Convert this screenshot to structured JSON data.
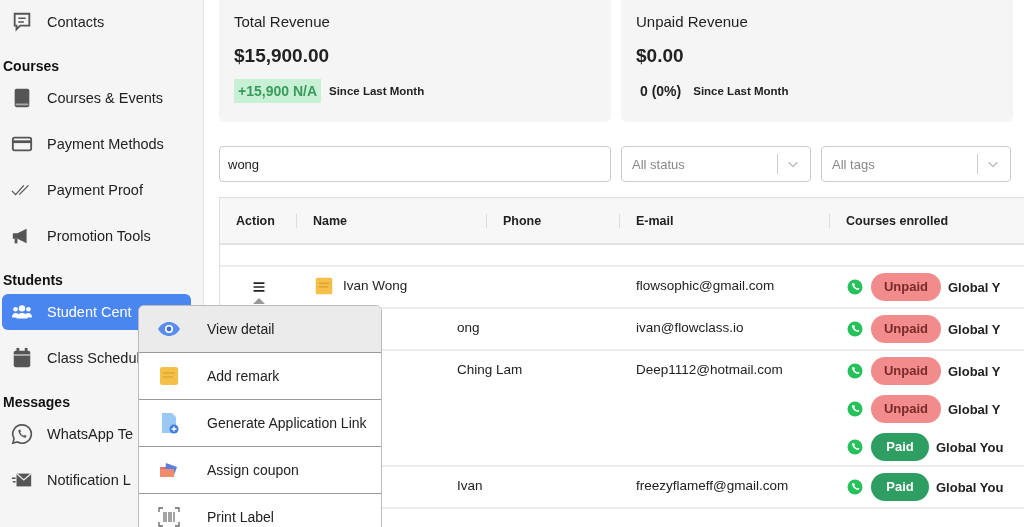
{
  "sidebar": {
    "sections": [
      {
        "items": [
          {
            "label": "Contacts",
            "selected": false
          }
        ]
      },
      {
        "heading": "Courses",
        "items": [
          {
            "label": "Courses & Events",
            "selected": false
          },
          {
            "label": "Payment Methods",
            "selected": false
          },
          {
            "label": "Payment Proof",
            "selected": false
          },
          {
            "label": "Promotion Tools",
            "selected": false
          }
        ]
      },
      {
        "heading": "Students",
        "items": [
          {
            "label": "Student Cent",
            "selected": true
          },
          {
            "label": "Class Schedul",
            "selected": false
          }
        ]
      },
      {
        "heading": "Messages",
        "items": [
          {
            "label": "WhatsApp Te",
            "selected": false
          },
          {
            "label": "Notification L",
            "selected": false
          }
        ]
      }
    ]
  },
  "stats": [
    {
      "title": "Total Revenue",
      "value": "$15,900.00",
      "change": "+15,900 N/A",
      "kind": "badge",
      "note": "Since Last Month"
    },
    {
      "title": "Unpaid Revenue",
      "value": "$0.00",
      "change": "0 (0%)",
      "kind": "plain",
      "note": "Since Last Month"
    }
  ],
  "filters": {
    "search": {
      "value": "wong"
    },
    "selects": [
      {
        "placeholder": "All status"
      },
      {
        "placeholder": "All tags"
      }
    ]
  },
  "table": {
    "columns": [
      "Action",
      "Name",
      "Phone",
      "E-mail",
      "Courses enrolled"
    ],
    "rows": [
      {
        "covered": false,
        "name": "Ivan Wong",
        "email": "flowsophic@gmail.com",
        "courses": [
          {
            "status": "Unpaid",
            "kind": "unpaid",
            "course": "Global Y"
          }
        ]
      },
      {
        "covered": true,
        "name": "ong",
        "email": "ivan@flowclass.io",
        "courses": [
          {
            "status": "Unpaid",
            "kind": "unpaid",
            "course": "Global Y"
          }
        ]
      },
      {
        "covered": true,
        "name": "Ching Lam",
        "email": "Deep1112@hotmail.com",
        "courses": [
          {
            "status": "Unpaid",
            "kind": "unpaid",
            "course": "Global Y"
          },
          {
            "status": "Unpaid",
            "kind": "unpaid",
            "course": "Global Y"
          },
          {
            "status": "Paid",
            "kind": "paid",
            "course": "Global You"
          }
        ]
      },
      {
        "covered": true,
        "name": "Ivan",
        "email": "freezyflameff@gmail.com",
        "courses": [
          {
            "status": "Paid",
            "kind": "paid",
            "course": "Global You"
          }
        ]
      }
    ]
  },
  "action_menu": {
    "items": [
      {
        "label": "View detail",
        "selected": true
      },
      {
        "label": "Add remark",
        "selected": false
      },
      {
        "label": "Generate Application Link",
        "selected": false
      },
      {
        "label": "Assign coupon",
        "selected": false
      },
      {
        "label": "Print Label",
        "selected": false
      }
    ]
  }
}
